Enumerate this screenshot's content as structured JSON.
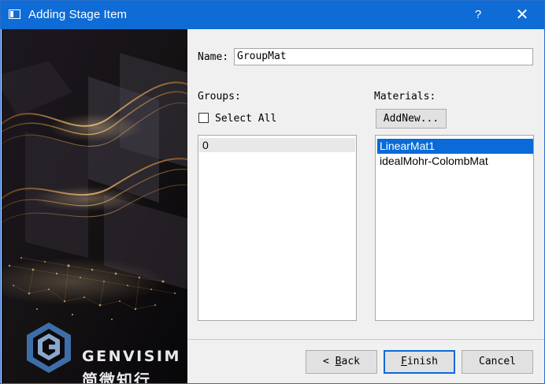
{
  "window": {
    "title": "Adding Stage Item",
    "help_label": "?",
    "close_label": "✕"
  },
  "banner": {
    "logo_name": "GENVISIM",
    "logo_subtitle": "简微知行",
    "logo_icon": "genvisim-logo-icon"
  },
  "form": {
    "name_label": "Name:",
    "name_value": "GroupMat",
    "groups_label": "Groups:",
    "materials_label": "Materials:",
    "select_all_label": "Select All",
    "select_all_checked": false,
    "add_new_label": "AddNew..."
  },
  "groups": {
    "items": [
      "0"
    ]
  },
  "materials": {
    "items": [
      "LinearMat1",
      "idealMohr-ColombMat"
    ],
    "selected": "LinearMat1"
  },
  "buttons": {
    "back_arrow": "<",
    "back_label": "Back",
    "finish_label": "Finish",
    "cancel_label": "Cancel"
  },
  "colors": {
    "titlebar": "#0f6cd6",
    "selection": "#0a6ad7",
    "banner_gold": "#d8a25a"
  }
}
